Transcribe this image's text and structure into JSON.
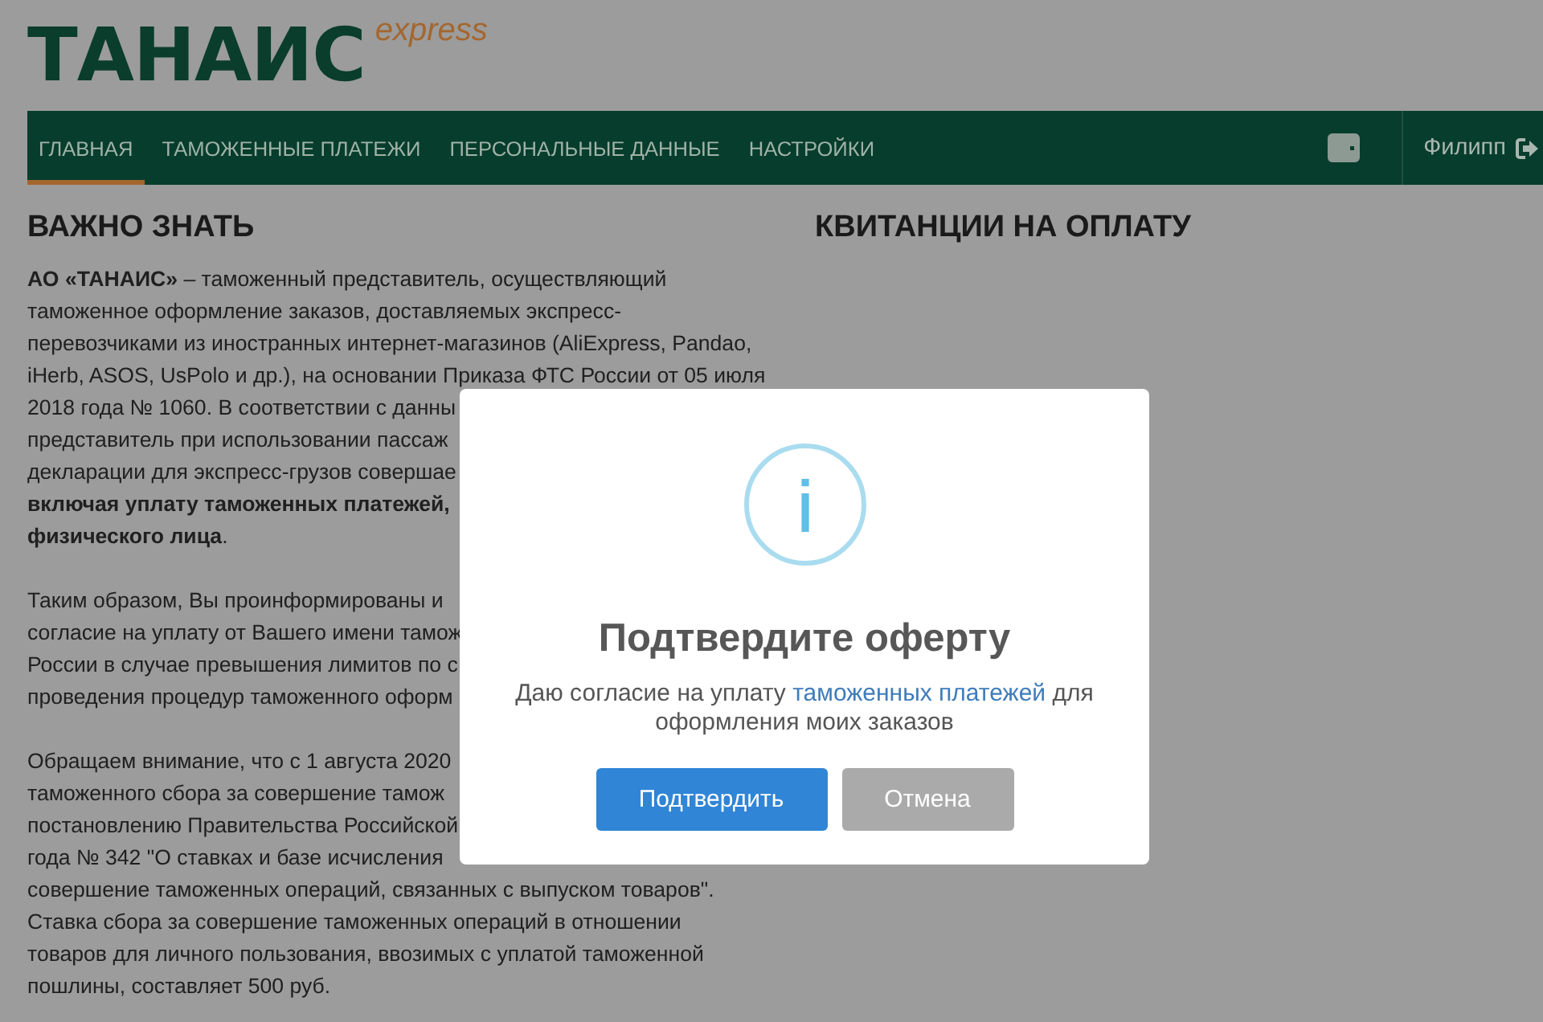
{
  "logo": {
    "name": "ТАНАИС",
    "tagline": "express"
  },
  "nav": {
    "items": [
      {
        "label": "ГЛАВНАЯ",
        "selected": true
      },
      {
        "label": "ТАМОЖЕННЫЕ ПЛАТЕЖИ",
        "selected": false
      },
      {
        "label": "ПЕРСОНАЛЬНЫЕ ДАННЫЕ",
        "selected": false
      },
      {
        "label": "НАСТРОЙКИ",
        "selected": false
      }
    ],
    "user": "Филипп"
  },
  "info": {
    "heading": "ВАЖНО ЗНАТЬ",
    "paragraphs": [
      {
        "lines": [
          {
            "text": "**АО «ТАНАИС»** – таможенный представитель, осуществляющий",
            "bold": false
          },
          {
            "text": "таможенное оформление заказов, доставляемых экспресс-",
            "bold": false
          },
          {
            "text": "перевозчиками из иностранных интернет-магазинов (AliExpress, Pandao,",
            "bold": false
          },
          {
            "text": "iHerb, ASOS, UsPolo и др.), на основании Приказа ФТС России от 05 июля",
            "bold": false
          },
          {
            "text": "2018 года № 1060. В соответствии с данны",
            "bold": false
          },
          {
            "text": "представитель при использовании пассаж",
            "bold": false
          },
          {
            "text": "декларации для экспресс-грузов совершае",
            "bold": false
          },
          {
            "text": "включая уплату таможенных платежей,",
            "bold": true
          },
          {
            "text": "**физического лица**.",
            "bold": false
          }
        ]
      },
      {
        "lines": [
          {
            "text": "Таким образом, Вы проинформированы и",
            "bold": false
          },
          {
            "text": "согласие на уплату от Вашего имени тамож",
            "bold": false
          },
          {
            "text": "России в случае превышения лимитов по с",
            "bold": false
          },
          {
            "text": "проведения процедур таможенного оформ",
            "bold": false
          }
        ]
      },
      {
        "lines": [
          {
            "text": "Обращаем внимание, что с 1 августа 2020",
            "bold": false
          },
          {
            "text": "таможенного сбора за совершение тамож",
            "bold": false
          },
          {
            "text": "постановлению Правительства Российской",
            "bold": false
          },
          {
            "text": "года № 342 \"О ставках и базе исчисления",
            "bold": false
          },
          {
            "text": "совершение таможенных операций, связанных с выпуском товаров\".",
            "bold": false
          },
          {
            "text": "Ставка сбора за совершение таможенных операций в отношении",
            "bold": false
          },
          {
            "text": "товаров для личного пользования, ввозимых с уплатой таможенной",
            "bold": false
          },
          {
            "text": "пошлины, составляет 500 руб.",
            "bold": false
          }
        ]
      }
    ]
  },
  "receipts": {
    "heading": "КВИТАНЦИИ НА ОПЛАТУ"
  },
  "modal": {
    "title": "Подтвердите оферту",
    "message": {
      "before": "Даю согласие на уплату",
      "link": "таможенных платежей",
      "after": "для оформления моих заказов"
    },
    "buttons": [
      {
        "label": "Подтвердить",
        "kind": "confirm"
      },
      {
        "label": "Отмена",
        "kind": "cancel"
      }
    ]
  }
}
